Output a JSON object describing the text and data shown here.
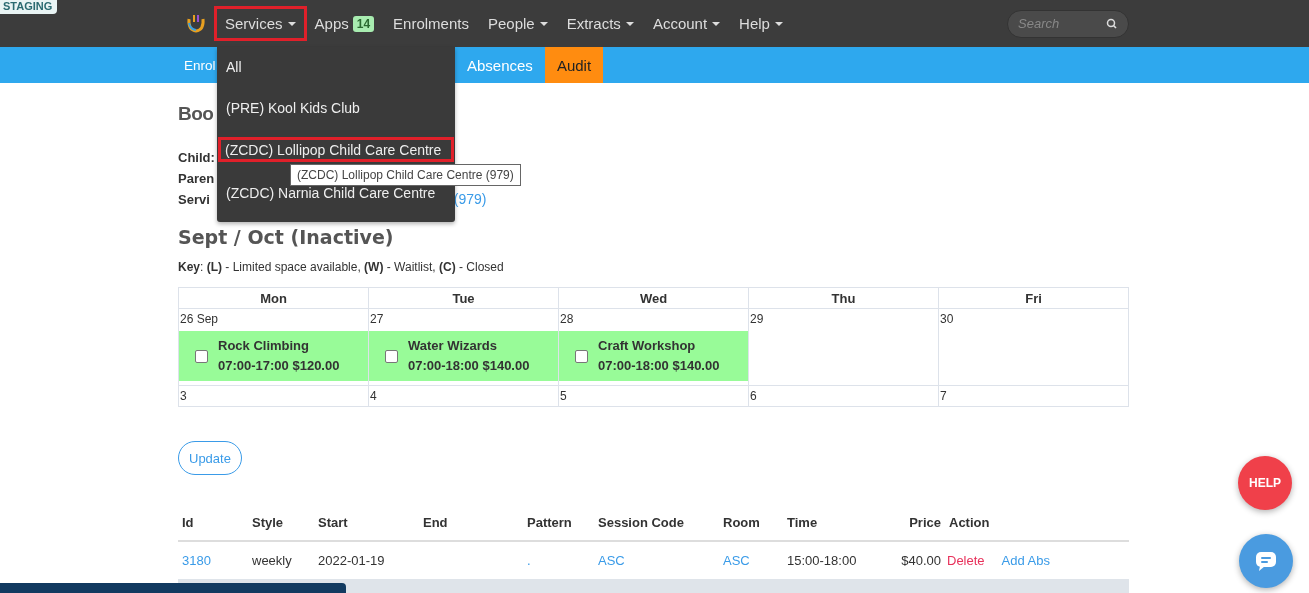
{
  "badge": "STAGING",
  "nav": {
    "items": [
      {
        "label": "Services",
        "menu": true,
        "highlighted": true
      },
      {
        "label": "Apps",
        "menu": false,
        "highlighted": false,
        "count": "14"
      },
      {
        "label": "Enrolments",
        "menu": false,
        "highlighted": false
      },
      {
        "label": "People",
        "menu": true,
        "highlighted": false
      },
      {
        "label": "Extracts",
        "menu": true,
        "highlighted": false
      },
      {
        "label": "Account",
        "menu": true,
        "highlighted": false
      },
      {
        "label": "Help",
        "menu": true,
        "highlighted": false
      }
    ],
    "search": {
      "placeholder": "Search"
    }
  },
  "dropdown": {
    "items": [
      {
        "label": "All",
        "selected": false
      },
      {
        "label": "(PRE) Kool Kids Club",
        "selected": false
      },
      {
        "label": "(ZCDC) Lollipop Child Care Centre",
        "selected": true
      },
      {
        "label": "(ZCDC) Narnia Child Care Centre",
        "selected": false
      }
    ],
    "tooltip": "(ZCDC) Lollipop Child Care Centre (979)"
  },
  "tabs": [
    {
      "label": "Enrol",
      "selected": false
    },
    {
      "label": "Absences",
      "selected": false
    },
    {
      "label": "Audit",
      "selected": true
    }
  ],
  "heading": "Boo",
  "details": [
    {
      "label": "Child:"
    },
    {
      "label": "Paren"
    },
    {
      "label": "Servi",
      "link": "(979)"
    }
  ],
  "period": "Sept / Oct  (Inactive)",
  "key": "**Key**: **(L)** - Limited space available, **(W)** - Waitlist, **(C)** - Closed",
  "calendar": {
    "days": [
      "Mon",
      "Tue",
      "Wed",
      "Thu",
      "Fri"
    ],
    "weeks": [
      [
        {
          "date": "26 Sep",
          "session": {
            "name": "Rock Climbing",
            "detail": "07:00-17:00 $120.00",
            "checked": false
          }
        },
        {
          "date": "27",
          "session": {
            "name": "Water Wizards",
            "detail": "07:00-18:00 $140.00",
            "checked": false
          }
        },
        {
          "date": "28",
          "session": {
            "name": "Craft Workshop",
            "detail": "07:00-18:00 $140.00",
            "checked": false
          }
        },
        {
          "date": "29"
        },
        {
          "date": "30"
        }
      ],
      [
        {
          "date": "3"
        },
        {
          "date": "4"
        },
        {
          "date": "5"
        },
        {
          "date": "6"
        },
        {
          "date": "7"
        }
      ]
    ]
  },
  "update_button": "Update",
  "table": {
    "columns": [
      "Id",
      "Style",
      "Start",
      "End",
      "Pattern",
      "Session Code",
      "Room",
      "Time",
      "Price",
      "Action"
    ],
    "rows": [
      {
        "id": "3180",
        "style": "weekly",
        "start": "2022-01-19",
        "pattern": ".",
        "session_code": "ASC",
        "room": "ASC",
        "time": "15:00-18:00",
        "price": "$40.00",
        "actions": [
          "Delete",
          "Add Abs"
        ]
      }
    ]
  },
  "help_button": "HELP"
}
